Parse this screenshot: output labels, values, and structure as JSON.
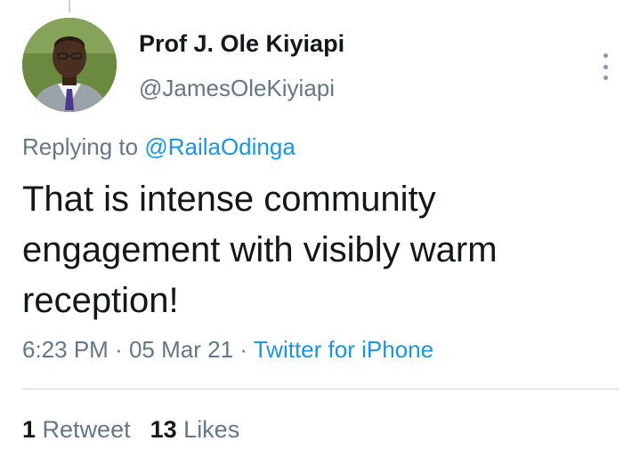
{
  "tweet": {
    "author": {
      "display_name": "Prof J. Ole Kiyiapi",
      "handle": "@JamesOleKiyiapi"
    },
    "replying_to_prefix": "Replying to ",
    "replying_to_handle": "@RailaOdinga",
    "text": "That is intense community engagement with visibly warm reception!",
    "time": "6:23 PM",
    "date": "05 Mar 21",
    "separator": "·",
    "source": "Twitter for iPhone",
    "stats": {
      "retweets_count": "1",
      "retweets_label": "Retweet",
      "likes_count": "13",
      "likes_label": "Likes"
    }
  },
  "icons": {
    "more": "more-vertical-icon",
    "avatar": "profile-photo"
  },
  "colors": {
    "link_blue": "#1b95e0",
    "secondary_text": "#657786",
    "primary_text": "#14171a",
    "divider": "#ccd6dd"
  }
}
